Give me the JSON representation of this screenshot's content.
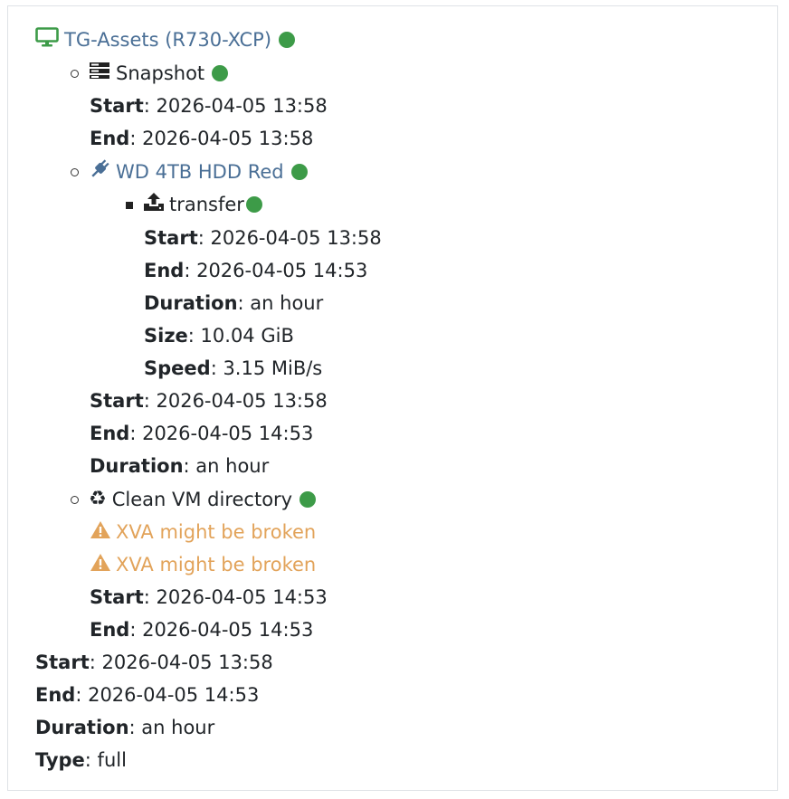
{
  "vm": {
    "name": "TG-Assets (R730-XCP)",
    "icon": "desktop-icon",
    "status_color": "#3d9b48"
  },
  "snapshot": {
    "label": "Snapshot",
    "icon": "server-icon",
    "start_label": "Start",
    "start": ": 2026-04-05 13:58",
    "end_label": "End",
    "end": ": 2026-04-05 13:58"
  },
  "remote": {
    "label": "WD 4TB HDD Red",
    "icon": "plug-icon",
    "transfer": {
      "label": "transfer",
      "icon": "upload-icon",
      "start_label": "Start",
      "start": ": 2026-04-05 13:58",
      "end_label": "End",
      "end": ": 2026-04-05 14:53",
      "duration_label": "Duration",
      "duration": ": an hour",
      "size_label": "Size",
      "size": ": 10.04 GiB",
      "speed_label": "Speed",
      "speed": ": 3.15 MiB/s"
    },
    "start_label": "Start",
    "start": ": 2026-04-05 13:58",
    "end_label": "End",
    "end": ": 2026-04-05 14:53",
    "duration_label": "Duration",
    "duration": ": an hour"
  },
  "clean": {
    "label": "Clean VM directory",
    "icon": "recycle-icon",
    "warnings": [
      "XVA might be broken",
      "XVA might be broken"
    ],
    "warning_icon": "warning-icon",
    "warning_color": "#e2a35a",
    "start_label": "Start",
    "start": ": 2026-04-05 14:53",
    "end_label": "End",
    "end": ": 2026-04-05 14:53"
  },
  "summary": {
    "start_label": "Start",
    "start": ": 2026-04-05 13:58",
    "end_label": "End",
    "end": ": 2026-04-05 14:53",
    "duration_label": "Duration",
    "duration": ": an hour",
    "type_label": "Type",
    "type": ": full"
  }
}
